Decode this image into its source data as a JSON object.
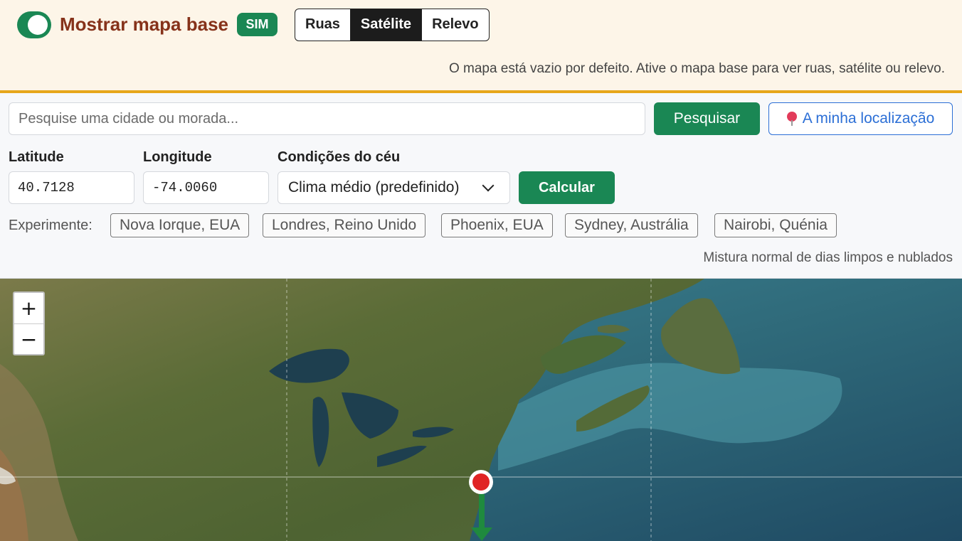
{
  "basemap": {
    "label": "Mostrar mapa base",
    "state_badge": "SIM",
    "enabled": true,
    "options": [
      "Ruas",
      "Satélite",
      "Relevo"
    ],
    "selected": "Satélite",
    "note": "O mapa está vazio por defeito. Ative o mapa base para ver ruas, satélite ou relevo."
  },
  "search": {
    "placeholder": "Pesquise uma cidade ou morada...",
    "button_label": "Pesquisar",
    "location_button_label": "A minha localização"
  },
  "coords": {
    "latitude_label": "Latitude",
    "latitude_value": "40.7128",
    "longitude_label": "Longitude",
    "longitude_value": "-74.0060"
  },
  "sky": {
    "label": "Condições do céu",
    "selected": "Clima médio (predefinido)",
    "calculate_label": "Calcular",
    "description": "Mistura normal de dias limpos e nublados"
  },
  "examples": {
    "label": "Experimente:",
    "items": [
      "Nova Iorque, EUA",
      "Londres, Reino Unido",
      "Phoenix, EUA",
      "Sydney, Austrália",
      "Nairobi, Quénia"
    ]
  },
  "map": {
    "zoom_in": "+",
    "zoom_out": "−",
    "colors": {
      "ocean": "#3b6f7c",
      "land": "#5d6f3a",
      "marker": "#e02424",
      "arrow": "#1f8a3e"
    }
  }
}
